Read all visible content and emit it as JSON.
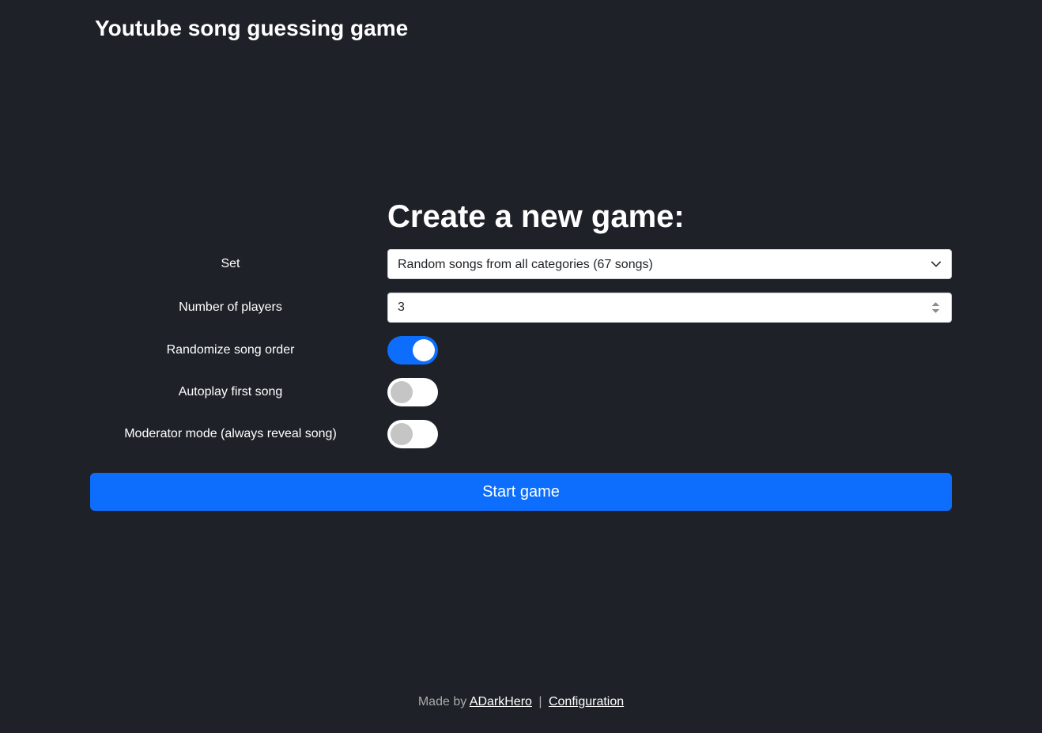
{
  "header": {
    "title": "Youtube song guessing game"
  },
  "form": {
    "title": "Create a new game:",
    "fields": {
      "set": {
        "label": "Set",
        "value": "Random songs from all categories (67 songs)"
      },
      "players": {
        "label": "Number of players",
        "value": "3"
      },
      "randomize": {
        "label": "Randomize song order",
        "checked": true
      },
      "autoplay": {
        "label": "Autoplay first song",
        "checked": false
      },
      "moderator": {
        "label": "Moderator mode (always reveal song)",
        "checked": false
      }
    },
    "submit_label": "Start game"
  },
  "footer": {
    "made_by_prefix": "Made by ",
    "author": "ADarkHero",
    "separator": " | ",
    "config_link": "Configuration"
  }
}
